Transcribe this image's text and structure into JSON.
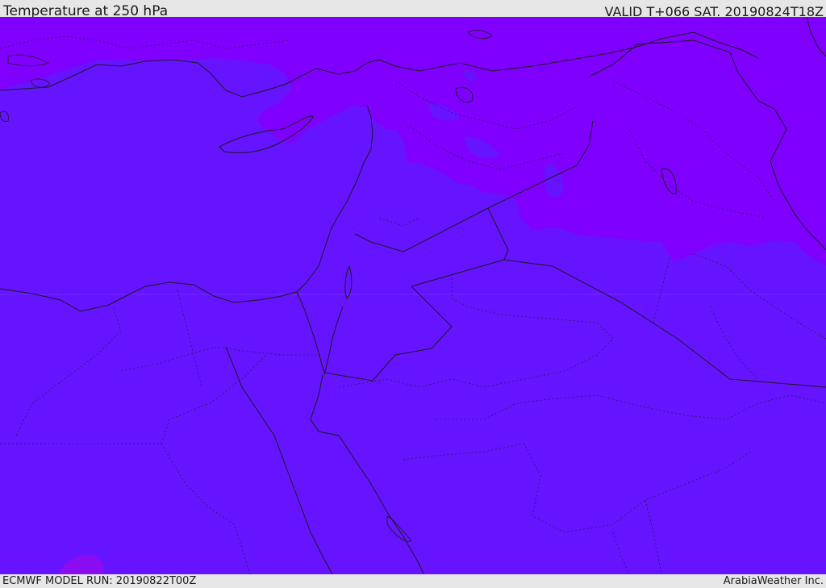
{
  "header": {
    "title": "Temperature at 250 hPa",
    "valid": "VALID T+066 SAT. 20190824T18Z"
  },
  "footer": {
    "model_run": "ECMWF MODEL RUN: 20190822T00Z",
    "credit": "ArabiaWeather Inc."
  },
  "map": {
    "field_colors": {
      "warmer_band": "#8000ff",
      "main_field": "#6614ff",
      "local_spot": "#8a0cf0"
    },
    "border_color": "#1a1a1a"
  }
}
